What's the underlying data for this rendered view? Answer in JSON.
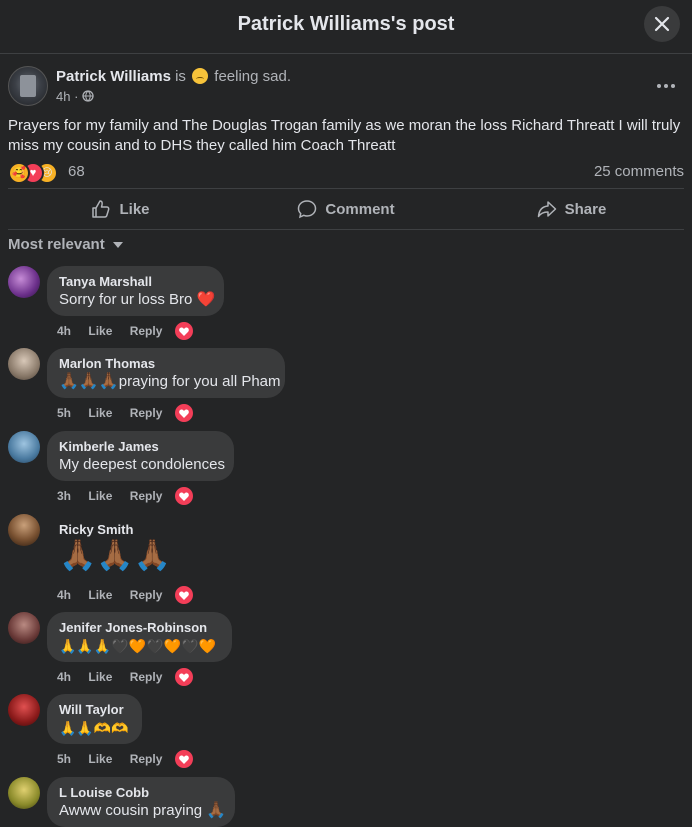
{
  "header": {
    "title": "Patrick Williams's post"
  },
  "post": {
    "author": "Patrick Williams",
    "is_text": "is",
    "feeling": "feeling sad.",
    "time": "4h ·",
    "text": "Prayers for my family and The Douglas Trogan family as we moran the loss Richard Threatt I will truly miss my cousin and to DHS they called him Coach Threatt",
    "reaction_count": "68",
    "comments_count": "25 comments"
  },
  "actions": {
    "like": "Like",
    "comment": "Comment",
    "share": "Share"
  },
  "sort": {
    "label": "Most relevant"
  },
  "comments": [
    {
      "name": "Tanya Marshall",
      "text": "Sorry for ur loss Bro",
      "emoji": "❤️",
      "time": "4h",
      "like": "Like",
      "reply": "Reply"
    },
    {
      "name": "Marlon Thomas",
      "emoji": "🙏🏾🙏🏾🙏🏾",
      "text": "praying for you all Pham",
      "time": "5h",
      "like": "Like",
      "reply": "Reply"
    },
    {
      "name": "Kimberle James",
      "text": "My deepest condolences",
      "time": "3h",
      "like": "Like",
      "reply": "Reply"
    },
    {
      "name": "Ricky Smith",
      "emoji": "🙏🏾🙏🏾🙏🏾",
      "time": "4h",
      "like": "Like",
      "reply": "Reply"
    },
    {
      "name": "Jenifer Jones-Robinson",
      "emoji": "🙏🙏🙏🖤🧡🖤🧡🖤🧡",
      "time": "4h",
      "like": "Like",
      "reply": "Reply"
    },
    {
      "name": "Will Taylor",
      "emoji": "🙏🙏🫶🫶",
      "time": "5h",
      "like": "Like",
      "reply": "Reply"
    },
    {
      "name": "L Louise Cobb",
      "text": "Awww cousin praying",
      "emoji": "🙏🏾"
    }
  ],
  "colors": {
    "background": "#242526",
    "bubble": "#3a3b3c",
    "love": "#f33e58",
    "text": "#e4e6eb",
    "muted": "#b0b3b8"
  }
}
